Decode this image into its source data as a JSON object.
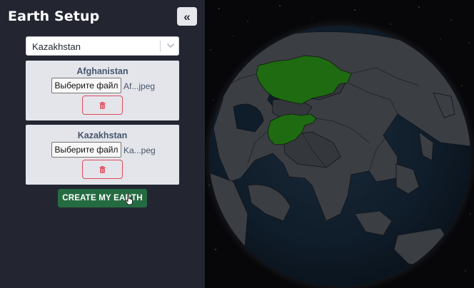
{
  "sidebar": {
    "title": "Earth Setup",
    "collapse_icon": "double-chevron-left-icon",
    "country_select": {
      "value": "Kazakhstan"
    },
    "cards": [
      {
        "country": "Afghanistan",
        "file_button": "Выберите файл",
        "file_name": "Af...jpeg"
      },
      {
        "country": "Kazakhstan",
        "file_button": "Выберите файл",
        "file_name": "Ka...peg"
      }
    ],
    "create_button": "CREATE MY EARTH"
  },
  "colors": {
    "sidebar_bg": "#232631",
    "card_bg": "#e4e5ea",
    "delete_accent": "#e0495a",
    "create_button": "#256b41",
    "highlight_country": "#1f6b12"
  },
  "globe": {
    "highlighted": [
      "Kazakhstan",
      "Afghanistan"
    ]
  }
}
